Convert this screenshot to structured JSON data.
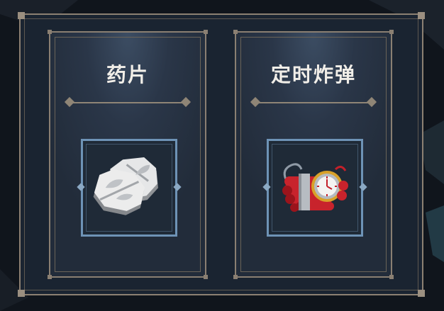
{
  "cards": [
    {
      "title": "药片",
      "item_icon": "pill-icon"
    },
    {
      "title": "定时炸弹",
      "item_icon": "time-bomb-icon"
    }
  ],
  "colors": {
    "frame": "#8c8072",
    "card_bg": "#2a3648",
    "slot_border": "#6e93b6",
    "title_text": "#f1eee8"
  }
}
